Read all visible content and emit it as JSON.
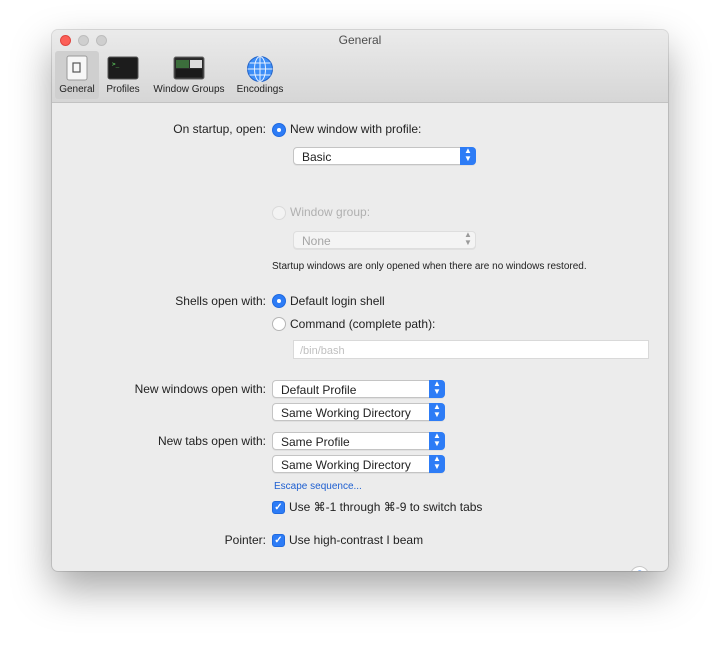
{
  "window": {
    "title": "General"
  },
  "toolbar": {
    "items": [
      {
        "label": "General",
        "icon": "general-icon",
        "selected": true
      },
      {
        "label": "Profiles",
        "icon": "profiles-icon",
        "selected": false
      },
      {
        "label": "Window Groups",
        "icon": "window-groups-icon",
        "selected": false
      },
      {
        "label": "Encodings",
        "icon": "globe-icon",
        "selected": false
      }
    ]
  },
  "startup": {
    "label": "On startup, open:",
    "option_profile": "New window with profile:",
    "profile_value": "Basic",
    "option_group": "Window group:",
    "group_value": "None",
    "note": "Startup windows are only opened when there are no windows restored."
  },
  "shells": {
    "label": "Shells open with:",
    "option_default": "Default login shell",
    "option_command": "Command (complete path):",
    "command_placeholder": "/bin/bash"
  },
  "new_windows": {
    "label": "New windows open with:",
    "profile_value": "Default Profile",
    "directory_value": "Same Working Directory"
  },
  "new_tabs": {
    "label": "New tabs open with:",
    "profile_value": "Same Profile",
    "directory_value": "Same Working Directory",
    "escape_link": "Escape sequence...",
    "switch_tabs_label": "Use ⌘-1 through ⌘-9 to switch tabs",
    "switch_tabs_checked": true
  },
  "pointer": {
    "label": "Pointer:",
    "option_label": "Use high-contrast I beam",
    "checked": true
  },
  "help": {
    "symbol": "?"
  },
  "colors": {
    "accent": "#2d7cf6",
    "close": "#fc5f57",
    "link": "#1e5fd1"
  }
}
